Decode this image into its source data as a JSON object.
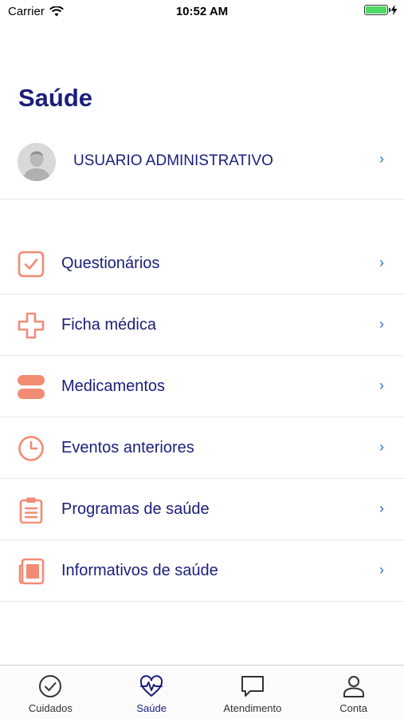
{
  "status_bar": {
    "carrier": "Carrier",
    "time": "10:52 AM",
    "battery_level": 1.0
  },
  "page": {
    "title": "Saúde"
  },
  "profile": {
    "name": "USUARIO ADMINISTRATIVO",
    "chevron": "›"
  },
  "menu": {
    "items": [
      {
        "label": "Questionários",
        "icon": "checkbox-icon",
        "chevron": "›"
      },
      {
        "label": "Ficha médica",
        "icon": "medical-cross-icon",
        "chevron": "›"
      },
      {
        "label": "Medicamentos",
        "icon": "pills-icon",
        "chevron": "›"
      },
      {
        "label": "Eventos anteriores",
        "icon": "clock-icon",
        "chevron": "›"
      },
      {
        "label": "Programas de saúde",
        "icon": "clipboard-icon",
        "chevron": "›"
      },
      {
        "label": "Informativos de saúde",
        "icon": "newspaper-icon",
        "chevron": "›"
      }
    ]
  },
  "tab_bar": {
    "tabs": [
      {
        "label": "Cuidados",
        "icon": "check-circle-icon",
        "active": false
      },
      {
        "label": "Saúde",
        "icon": "heart-pulse-icon",
        "active": true
      },
      {
        "label": "Atendimento",
        "icon": "chat-bubble-icon",
        "active": false
      },
      {
        "label": "Conta",
        "icon": "person-icon",
        "active": false
      }
    ]
  },
  "colors": {
    "primary": "#1b1e7a",
    "accent": "#f28b73",
    "chevron": "#2f6fbf",
    "battery": "#4cd964"
  }
}
